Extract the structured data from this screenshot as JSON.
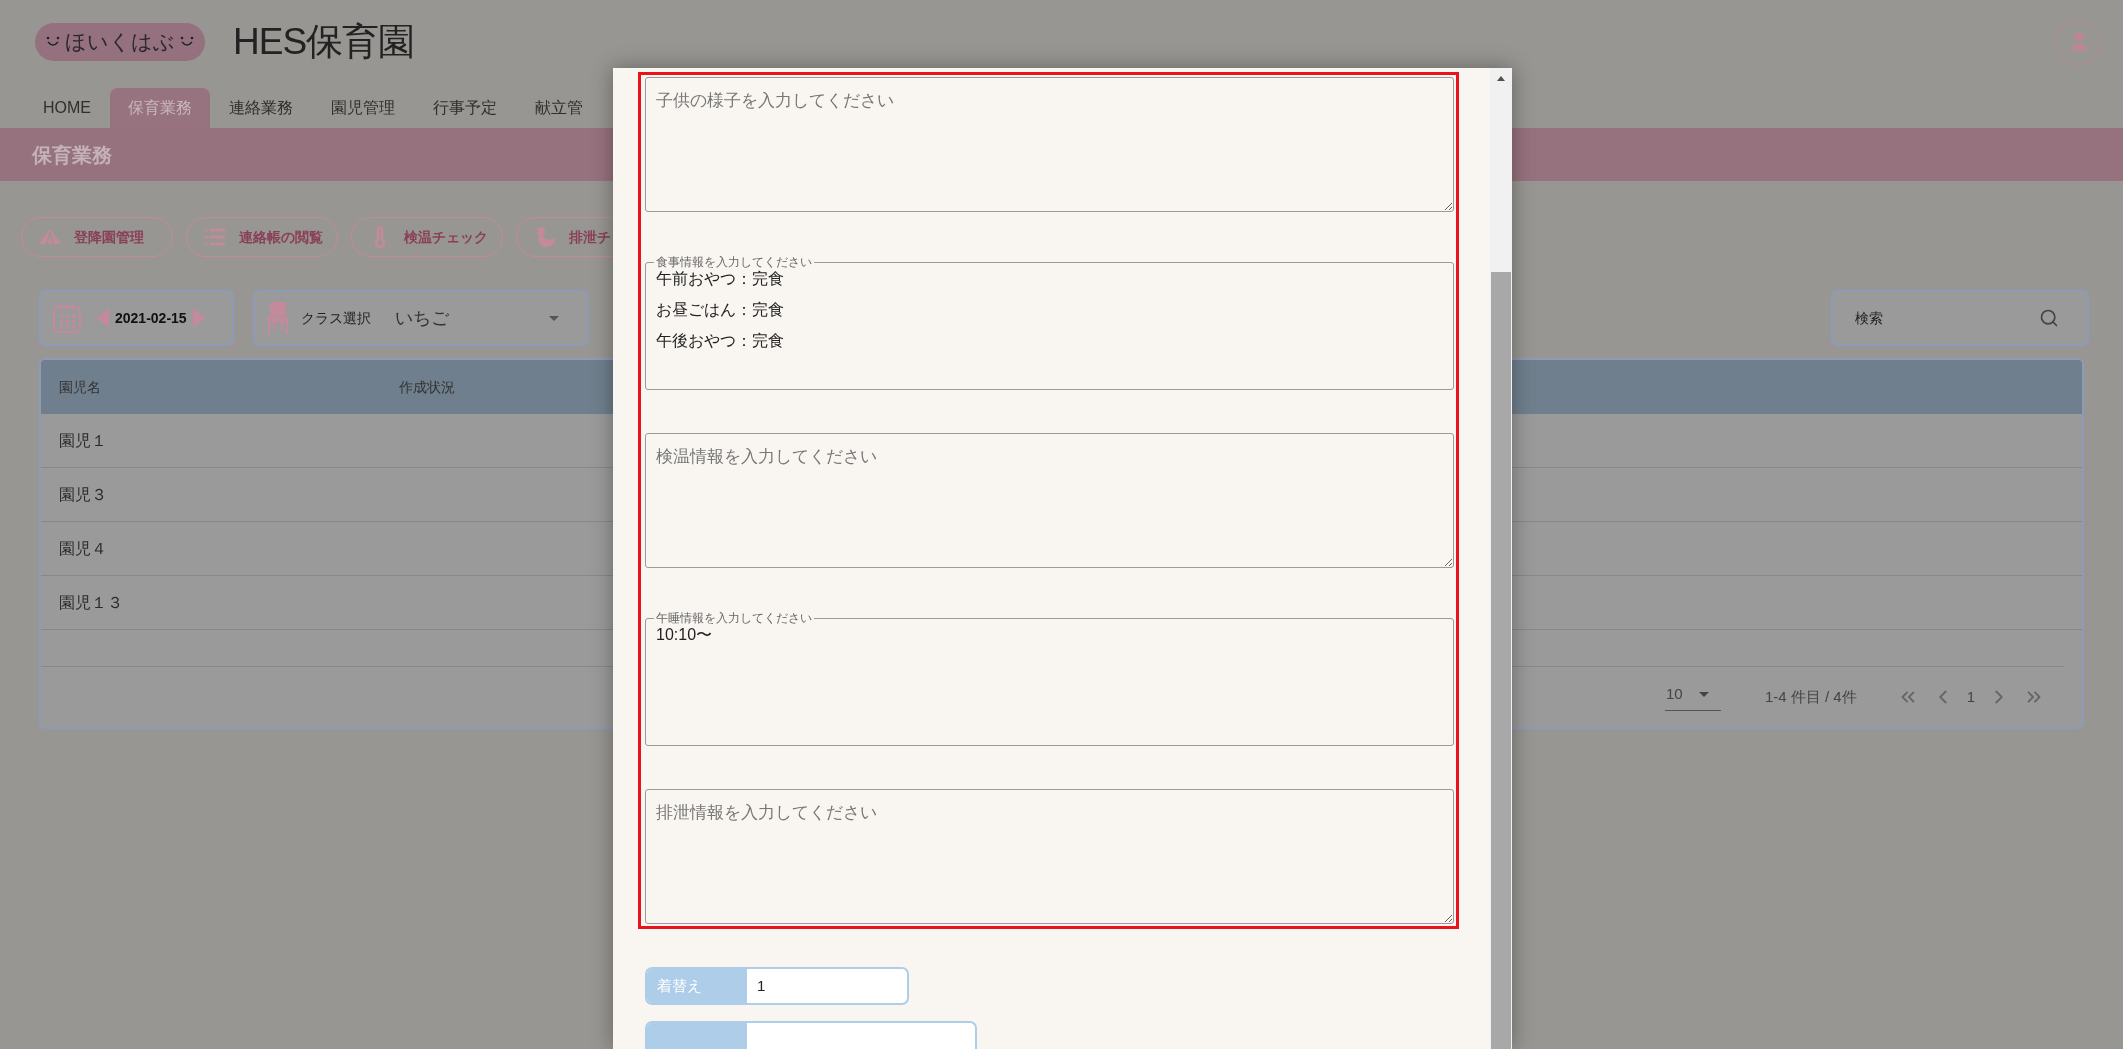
{
  "header": {
    "logo": "ほいくはぶ",
    "title": "HES保育園"
  },
  "nav_tabs": [
    {
      "label": "HOME",
      "selected": false
    },
    {
      "label": "保育業務",
      "selected": true
    },
    {
      "label": "連絡業務",
      "selected": false
    },
    {
      "label": "園児管理",
      "selected": false
    },
    {
      "label": "行事予定",
      "selected": false
    },
    {
      "label": "献立管",
      "selected": false
    }
  ],
  "page_heading": "保育業務",
  "action_buttons": [
    {
      "kind": "tent",
      "label": "登降園管理"
    },
    {
      "kind": "list",
      "label": "連絡帳の閲覧"
    },
    {
      "kind": "thermometer",
      "label": "検温チェック"
    },
    {
      "kind": "duck",
      "label": "排泄チ"
    }
  ],
  "date_picker": {
    "date": "2021-02-15"
  },
  "class_select": {
    "label": "クラス選択",
    "value": "いちご"
  },
  "search": {
    "placeholder": "検索"
  },
  "table": {
    "columns": [
      "園児名",
      "作成状況"
    ],
    "rows": [
      [
        "園児１"
      ],
      [
        "園児３"
      ],
      [
        "園児４"
      ],
      [
        "園児１３"
      ]
    ]
  },
  "pagination": {
    "per_page": "10",
    "range": "1-4 件目 / 4件",
    "page": "1"
  },
  "modal": {
    "highlighted": true,
    "fields": [
      {
        "placeholder": "子供の様子を入力してください"
      },
      {
        "label": "食事情報を入力してください",
        "value": [
          "午前おやつ：完食",
          "お昼ごはん：完食",
          "午後おやつ：完食"
        ]
      },
      {
        "placeholder": "検温情報を入力してください"
      },
      {
        "label": "午睡情報を入力してください",
        "value": [
          "10:10〜"
        ]
      },
      {
        "placeholder": "排泄情報を入力してください"
      }
    ],
    "form_rows": [
      {
        "kind": "full",
        "label": "着替え",
        "value": "1"
      },
      {
        "kind": "cut"
      }
    ]
  }
}
